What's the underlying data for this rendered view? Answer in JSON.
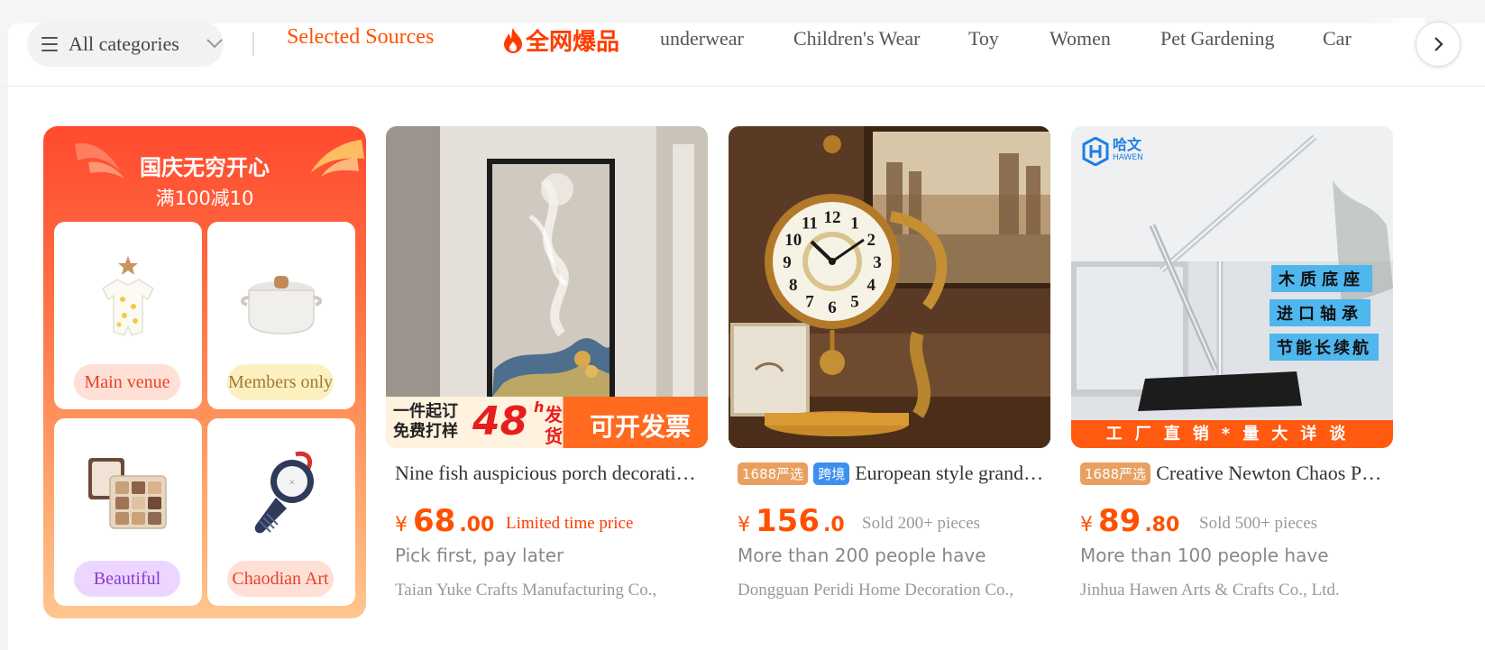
{
  "colors": {
    "accent": "#ff5000",
    "badge_yanxuan": "#e8a060",
    "badge_cross_border": "#3d8ff0"
  },
  "nav": {
    "categories_label": "All categories",
    "selected_label": "Selected Sources",
    "hot_label": "全网爆品",
    "items": [
      "underwear",
      "Children's Wear",
      "Toy",
      "Women",
      "Pet Gardening",
      "Car"
    ]
  },
  "promo": {
    "title": "国庆无穷开心",
    "subtitle": "满100减10",
    "tiles": [
      {
        "label": "Main venue",
        "icon": "baby-romper-icon"
      },
      {
        "label": "Members only",
        "icon": "casserole-pot-icon"
      },
      {
        "label": "Beautiful",
        "icon": "eyeshadow-palette-icon"
      },
      {
        "label": "Chaodian Art",
        "icon": "usb-charger-icon"
      }
    ]
  },
  "products": [
    {
      "title": "Nine fish auspicious porch decorative painting",
      "price_yen": "¥",
      "price_int": "68",
      "price_dec": ".00",
      "tag": "Limited time price",
      "info": "Pick first, pay later",
      "company": "Taian Yuke Crafts Manufacturing Co.,",
      "banner": {
        "line1": "一件起订",
        "line2": "免费打样",
        "num": "48",
        "h": "h",
        "fa": "发",
        "huo": "货",
        "right": "可开发票"
      }
    },
    {
      "badges": [
        "1688严选",
        "跨境"
      ],
      "title": "European style grandfather clock",
      "price_yen": "¥",
      "price_int": "156",
      "price_dec": ".0",
      "tag": "Sold 200+ pieces",
      "info": "More than 200 people have",
      "company": "Dongguan Peridi Home Decoration Co.,",
      "clock_numbers": [
        "12",
        "1",
        "2",
        "3",
        "4",
        "5",
        "6",
        "7",
        "8",
        "9",
        "10",
        "11"
      ]
    },
    {
      "badges": [
        "1688严选"
      ],
      "title": "Creative Newton Chaos Pendulum",
      "price_yen": "¥",
      "price_int": "89",
      "price_dec": ".80",
      "tag": "Sold 500+ pieces",
      "info": "More than 100 people have",
      "company": "Jinhua Hawen Arts & Crafts Co., Ltd.",
      "brand_cn": "哈文",
      "brand_en": "HAWEN",
      "features": [
        "木质底座",
        "进口轴承",
        "节能长续航"
      ],
      "banner": "工厂直销*量大详谈"
    }
  ]
}
